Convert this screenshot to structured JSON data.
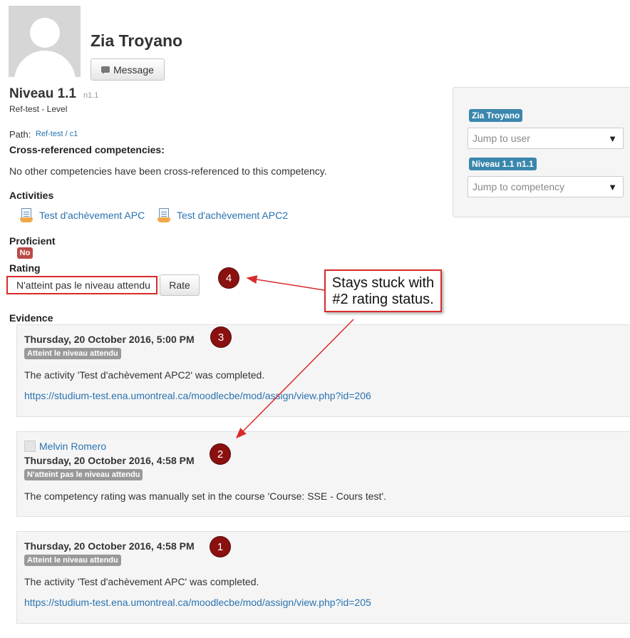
{
  "user": {
    "name": "Zia Troyano",
    "message_label": "Message"
  },
  "competency": {
    "title": "Niveau 1.1",
    "idnumber": "n1.1",
    "subtitle": "Ref-test - Level",
    "path_label": "Path:",
    "path_link": "Ref-test / c1",
    "crossref_heading": "Cross-referenced competencies:",
    "crossref_text": "No other competencies have been cross-referenced to this competency."
  },
  "activities": {
    "heading": "Activities",
    "items": [
      "Test d'achèvement APC",
      "Test d'achèvement APC2"
    ]
  },
  "proficient": {
    "heading": "Proficient",
    "value": "No"
  },
  "rating": {
    "heading": "Rating",
    "selected": "N'atteint pas le niveau attendu",
    "rate_label": "Rate"
  },
  "evidence": {
    "heading": "Evidence",
    "items": [
      {
        "date": "Thursday, 20 October 2016, 5:00 PM",
        "badge": "Atteint le niveau attendu",
        "text": "The activity 'Test d'achèvement APC2' was completed.",
        "link": "https://studium-test.ena.umontreal.ca/moodlecbe/mod/assign/view.php?id=206"
      },
      {
        "author": "Melvin Romero",
        "date": "Thursday, 20 October 2016, 4:58 PM",
        "badge": "N'atteint pas le niveau attendu",
        "text": "The competency rating was manually set in the course 'Course: SSE - Cours test'."
      },
      {
        "date": "Thursday, 20 October 2016, 4:58 PM",
        "badge": "Atteint le niveau attendu",
        "text": "The activity 'Test d'achèvement APC' was completed.",
        "link": "https://studium-test.ena.umontreal.ca/moodlecbe/mod/assign/view.php?id=205"
      }
    ]
  },
  "sidebar": {
    "user_badge": "Zia Troyano",
    "jump_user_placeholder": "Jump to user",
    "comp_badge": "Niveau 1.1 n1.1",
    "jump_comp_placeholder": "Jump to competency"
  },
  "annotations": {
    "callout_line1": "Stays stuck with",
    "callout_line2": "#2 rating status.",
    "markers": [
      "1",
      "2",
      "3",
      "4"
    ]
  },
  "colors": {
    "link": "#2a73b0",
    "danger_badge": "#b94a48",
    "info_badge": "#3a87ad",
    "grey_badge": "#999999",
    "annotation_red": "#d92b2b",
    "marker": "#8b1010"
  },
  "icons": [
    "message-icon",
    "activity-assign-icon",
    "chevron-down-icon",
    "user-avatar-icon"
  ]
}
